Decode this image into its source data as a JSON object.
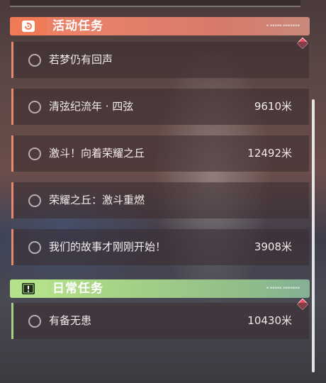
{
  "sections": [
    {
      "title": "活动任务",
      "icon": "event-refresh-icon",
      "accent": "#f07a56",
      "tasks": [
        {
          "name": "若梦仍有回声",
          "distance": ""
        },
        {
          "name": "清弦纪流年 · 四弦",
          "distance": "9610米"
        },
        {
          "name": "激斗！向着荣耀之丘",
          "distance": "12492米"
        },
        {
          "name": "荣耀之丘：激斗重燃",
          "distance": ""
        },
        {
          "name": "我们的故事才刚刚开始！",
          "distance": "3908米"
        }
      ]
    },
    {
      "title": "日常任务",
      "icon": "daily-alert-icon",
      "accent": "#b4e28a",
      "tasks": [
        {
          "name": "有备无患",
          "distance": "10430米"
        }
      ]
    }
  ],
  "colors": {
    "notification": "#e05262"
  }
}
